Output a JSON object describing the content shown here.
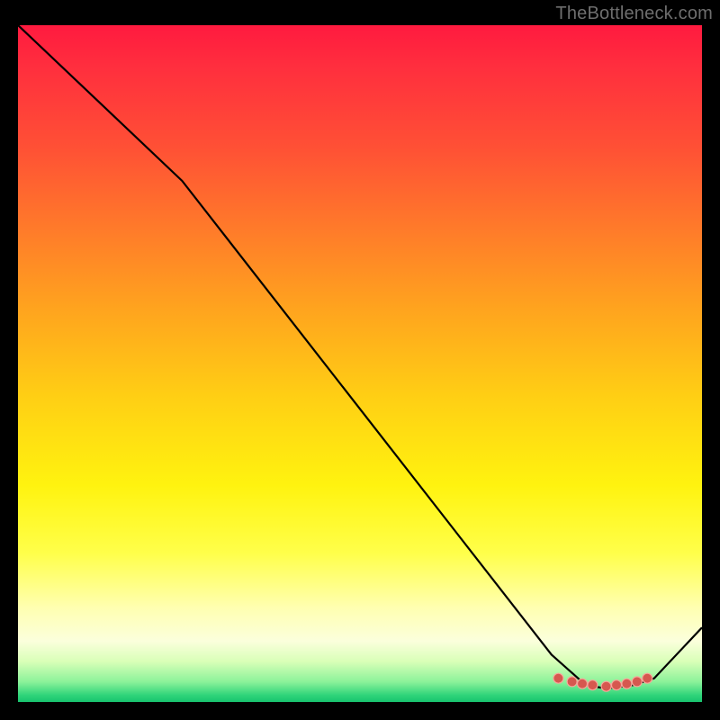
{
  "watermark": "TheBottleneck.com",
  "chart_data": {
    "type": "line",
    "title": "",
    "xlabel": "",
    "ylabel": "",
    "x_range": [
      0,
      100
    ],
    "y_range": [
      0,
      100
    ],
    "curve": [
      {
        "x": 0,
        "y": 100
      },
      {
        "x": 24,
        "y": 77
      },
      {
        "x": 78,
        "y": 7
      },
      {
        "x": 83,
        "y": 2.5
      },
      {
        "x": 86,
        "y": 2
      },
      {
        "x": 90,
        "y": 2.5
      },
      {
        "x": 93,
        "y": 3.5
      },
      {
        "x": 100,
        "y": 11
      }
    ],
    "markers": [
      {
        "x": 79,
        "y": 3.5
      },
      {
        "x": 81,
        "y": 3.0
      },
      {
        "x": 82.5,
        "y": 2.7
      },
      {
        "x": 84,
        "y": 2.5
      },
      {
        "x": 86,
        "y": 2.3
      },
      {
        "x": 87.5,
        "y": 2.5
      },
      {
        "x": 89,
        "y": 2.7
      },
      {
        "x": 90.5,
        "y": 3.0
      },
      {
        "x": 92,
        "y": 3.5
      }
    ],
    "colors": {
      "curve": "#000000",
      "marker_fill": "#d6584f",
      "marker_stroke": "#f7a59a",
      "gradient_top": "#ff1a3f",
      "gradient_bottom": "#17c36e"
    }
  }
}
